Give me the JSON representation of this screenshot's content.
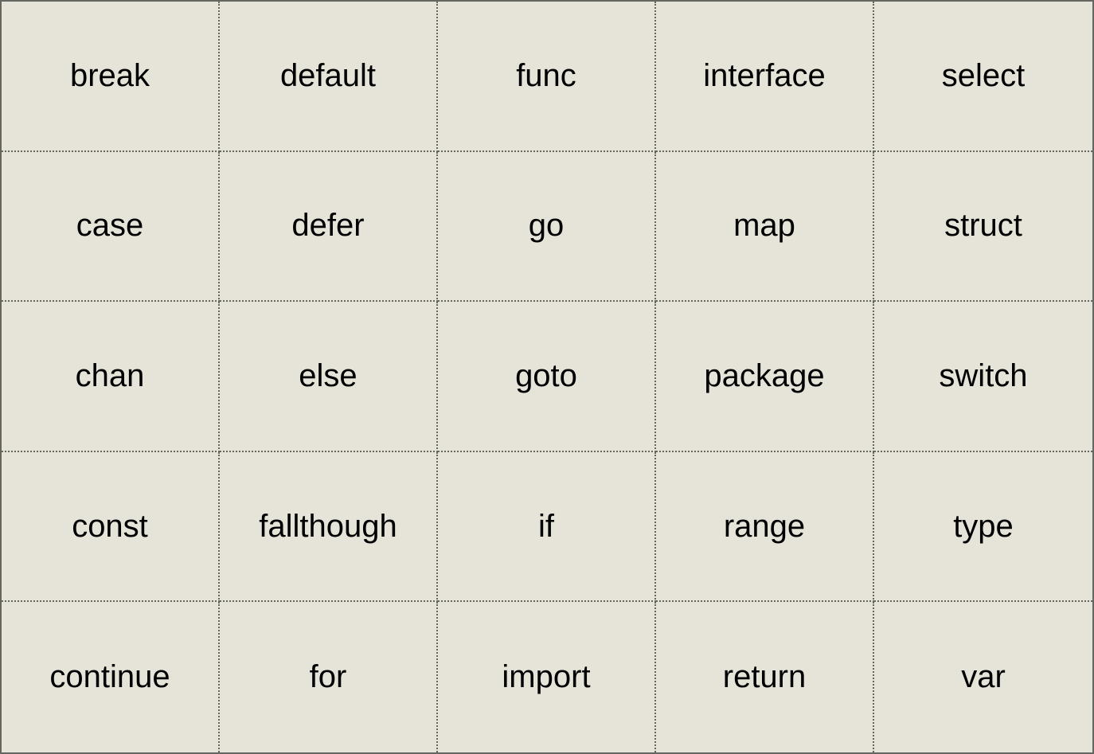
{
  "grid": {
    "columns": 5,
    "cells": [
      "break",
      "default",
      "func",
      "interface",
      "select",
      "case",
      "defer",
      "go",
      "map",
      "struct",
      "chan",
      "else",
      "goto",
      "package",
      "switch",
      "const",
      "fallthough",
      "if",
      "range",
      "type",
      "continue",
      "for",
      "import",
      "return",
      "var"
    ]
  },
  "colors": {
    "background": "#e6e3d8",
    "border": "#666660",
    "text": "#000000"
  }
}
